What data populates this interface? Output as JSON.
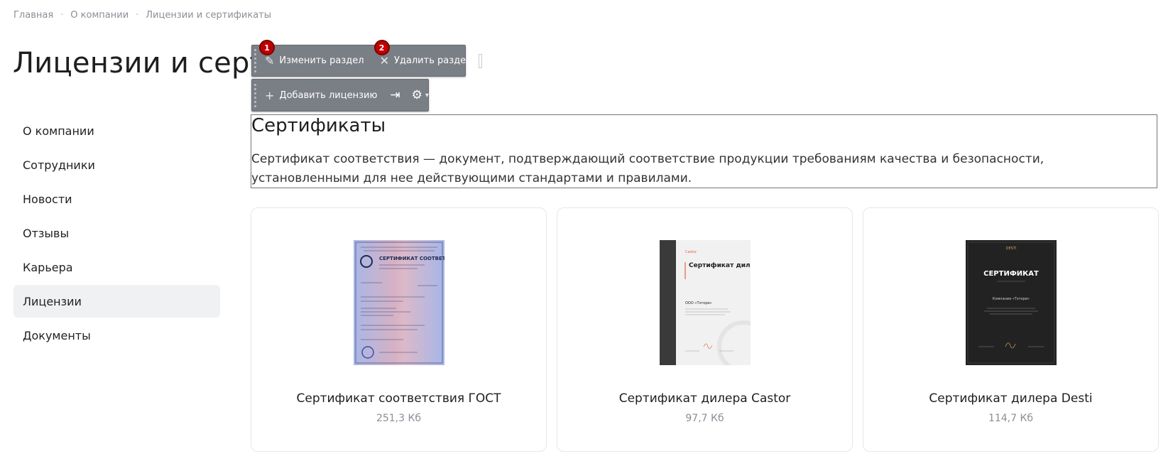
{
  "breadcrumb": [
    {
      "label": "Главная"
    },
    {
      "label": "О компании"
    },
    {
      "label": "Лицензии и сертификаты"
    }
  ],
  "page": {
    "title": "Лицензии и сертификаты"
  },
  "sidebar": {
    "items": [
      {
        "label": "О компании"
      },
      {
        "label": "Сотрудники"
      },
      {
        "label": "Новости"
      },
      {
        "label": "Отзывы"
      },
      {
        "label": "Карьера"
      },
      {
        "label": "Лицензии",
        "active": true
      },
      {
        "label": "Документы"
      }
    ]
  },
  "toolbar": {
    "edit_section": {
      "label": "Изменить раздел",
      "badge": "1"
    },
    "delete_section": {
      "label": "Удалить раздел",
      "badge": "2"
    },
    "add_license": {
      "label": "Добавить лицензию"
    }
  },
  "section": {
    "title": "Сертификаты",
    "description": "Сертификат соответствия — документ, подтверждающий соответствие продукции требованиям качества и безопасности, установленными для нее действующими стандартами и правилами."
  },
  "cards": [
    {
      "title": "Сертификат соответствия ГОСТ",
      "size": "251,3 Кб"
    },
    {
      "title": "Сертификат дилера Castor",
      "size": "97,7 Кб"
    },
    {
      "title": "Сертификат дилера Desti",
      "size": "114,7 Кб"
    }
  ],
  "thumbs": {
    "gost_heading": "СЕРТИФИКАТ СООТВЕТСТВИЯ",
    "castor_brand": "Castor",
    "castor_heading": "Сертификат дилера",
    "castor_company": "ООО «Тэтори»",
    "desti_brand": "DESTI",
    "desti_heading": "СЕРТИФИКАТ",
    "desti_company": "Компания «Тэтори»"
  }
}
